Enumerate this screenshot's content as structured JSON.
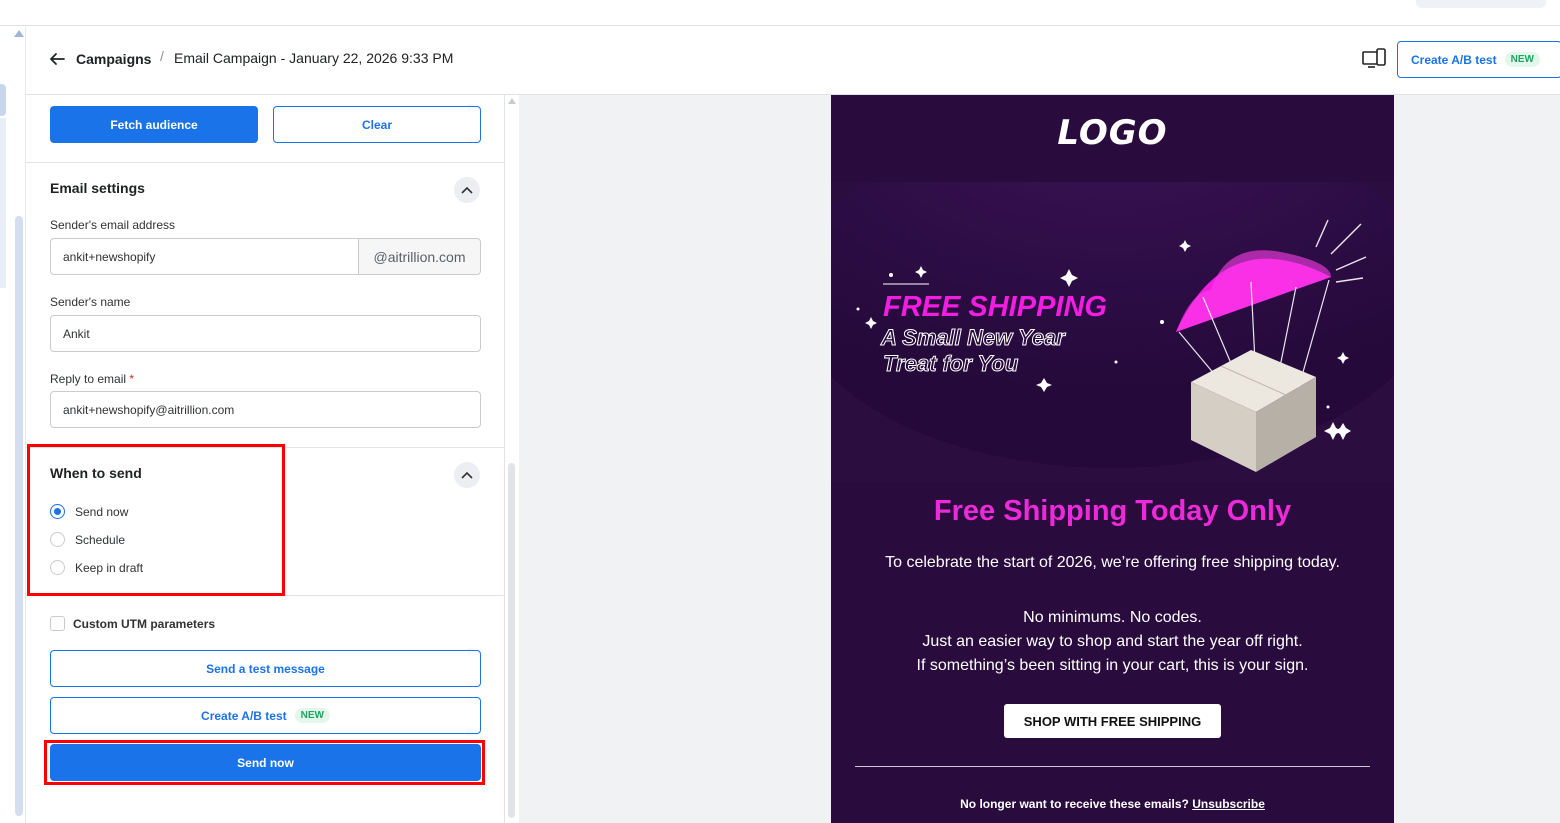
{
  "header": {
    "breadcrumb_root": "Campaigns",
    "breadcrumb_separator": "/",
    "campaign_title": "Email Campaign - January 22, 2026 9:33 PM",
    "ab_test_label": "Create A/B test",
    "ab_test_badge": "NEW"
  },
  "audience": {
    "fetch_label": "Fetch audience",
    "clear_label": "Clear"
  },
  "email_settings": {
    "title": "Email settings",
    "sender_email_label": "Sender's email address",
    "sender_email_value": "ankit+newshopify",
    "sender_email_domain": "@aitrillion.com",
    "sender_name_label": "Sender's name",
    "sender_name_value": "Ankit",
    "reply_to_label": "Reply to email",
    "reply_to_required": "*",
    "reply_to_value": "ankit+newshopify@aitrillion.com"
  },
  "when_to_send": {
    "title": "When to send",
    "options": [
      {
        "label": "Send now",
        "selected": true
      },
      {
        "label": "Schedule",
        "selected": false
      },
      {
        "label": "Keep in draft",
        "selected": false
      }
    ]
  },
  "footer_actions": {
    "utm_label": "Custom UTM parameters",
    "test_message_label": "Send a test message",
    "ab_test_label": "Create A/B test",
    "ab_test_badge": "NEW",
    "send_now_label": "Send now"
  },
  "email_preview": {
    "logo_text": "LOGO",
    "hero_line1": "FREE SHIPPING",
    "hero_line2": "A Small New Year",
    "hero_line3": "Treat for You",
    "headline": "Free Shipping Today Only",
    "intro": "To celebrate the start of 2026, we’re offering free shipping today.",
    "lines": [
      "No minimums. No codes.",
      "Just an easier way to shop and start the year off right.",
      "If something’s been sitting in your cart, this is your sign."
    ],
    "cta_label": "SHOP WITH FREE SHIPPING",
    "unsubscribe_text": "No longer want to receive these emails?",
    "unsubscribe_link": "Unsubscribe"
  },
  "colors": {
    "primary": "#1a73e8",
    "email_bg": "#2a0b3d",
    "headline_pink": "#ec2ad9",
    "highlight_red": "#ff0000"
  }
}
